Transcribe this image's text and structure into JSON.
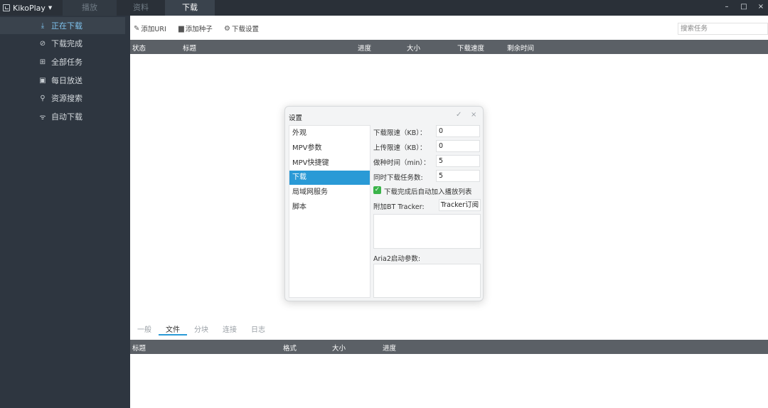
{
  "titlebar": {
    "app_name": "KikoPlay",
    "menu_caret": "▼",
    "tabs": [
      {
        "label": "播放",
        "state": "normal"
      },
      {
        "label": "资料",
        "state": "normal"
      },
      {
        "label": "下载",
        "state": "active"
      }
    ],
    "window_buttons": {
      "minimize": "–",
      "maximize": "□",
      "close": "×"
    }
  },
  "sidebar": {
    "items": [
      {
        "icon": "download-icon",
        "glyph": "⤓",
        "label": "正在下载",
        "active": true
      },
      {
        "icon": "check-circle-icon",
        "glyph": "⊘",
        "label": "下载完成",
        "active": false
      },
      {
        "icon": "grid-icon",
        "glyph": "⊞",
        "label": "全部任务",
        "active": false
      },
      {
        "icon": "calendar-icon",
        "glyph": "▣",
        "label": "每日放送",
        "active": false
      },
      {
        "icon": "search-icon",
        "glyph": "⚲",
        "label": "资源搜索",
        "active": false
      },
      {
        "icon": "rss-icon",
        "glyph": "ᯤ",
        "label": "自动下载",
        "active": false
      }
    ]
  },
  "toolbar": {
    "add_uri": {
      "icon": "edit-icon",
      "glyph": "✎",
      "label": "添加URI"
    },
    "add_torrent": {
      "icon": "file-icon",
      "glyph": "▆",
      "label": "添加种子"
    },
    "download_settings": {
      "icon": "gear-icon",
      "glyph": "⚙",
      "label": "下载设置"
    },
    "search_placeholder": "搜索任务"
  },
  "task_table": {
    "columns": [
      "状态",
      "标题",
      "进度",
      "大小",
      "下载速度",
      "剩余时间"
    ],
    "rows": []
  },
  "bottom_tabs": [
    {
      "label": "一般",
      "active": false
    },
    {
      "label": "文件",
      "active": true
    },
    {
      "label": "分块",
      "active": false
    },
    {
      "label": "连接",
      "active": false
    },
    {
      "label": "日志",
      "active": false
    }
  ],
  "file_table": {
    "columns": [
      "标题",
      "格式",
      "大小",
      "进度"
    ],
    "rows": []
  },
  "settings_dialog": {
    "title": "设置",
    "ok_glyph": "✓",
    "close_glyph": "×",
    "nav": [
      {
        "label": "外观",
        "active": false
      },
      {
        "label": "MPV参数",
        "active": false
      },
      {
        "label": "MPV快捷键",
        "active": false
      },
      {
        "label": "下载",
        "active": true
      },
      {
        "label": "局域网服务",
        "active": false
      },
      {
        "label": "脚本",
        "active": false
      }
    ],
    "download_limit": {
      "label": "下载限速（KB）：",
      "value": "0"
    },
    "upload_limit": {
      "label": "上传限速（KB）：",
      "value": "0"
    },
    "seed_time": {
      "label": "做种时间（min）：",
      "value": "5"
    },
    "concurrent_tasks": {
      "label": "同时下载任务数:",
      "value": "5"
    },
    "auto_add_playlist": {
      "label": "下载完成后自动加入播放列表",
      "checked": true,
      "glyph": "✓"
    },
    "bt_tracker": {
      "label": "附加BT Tracker:",
      "button": "Tracker订阅"
    },
    "aria2_args": {
      "label": "Aria2启动参数:"
    },
    "accent_color": "#2a9ad6"
  }
}
